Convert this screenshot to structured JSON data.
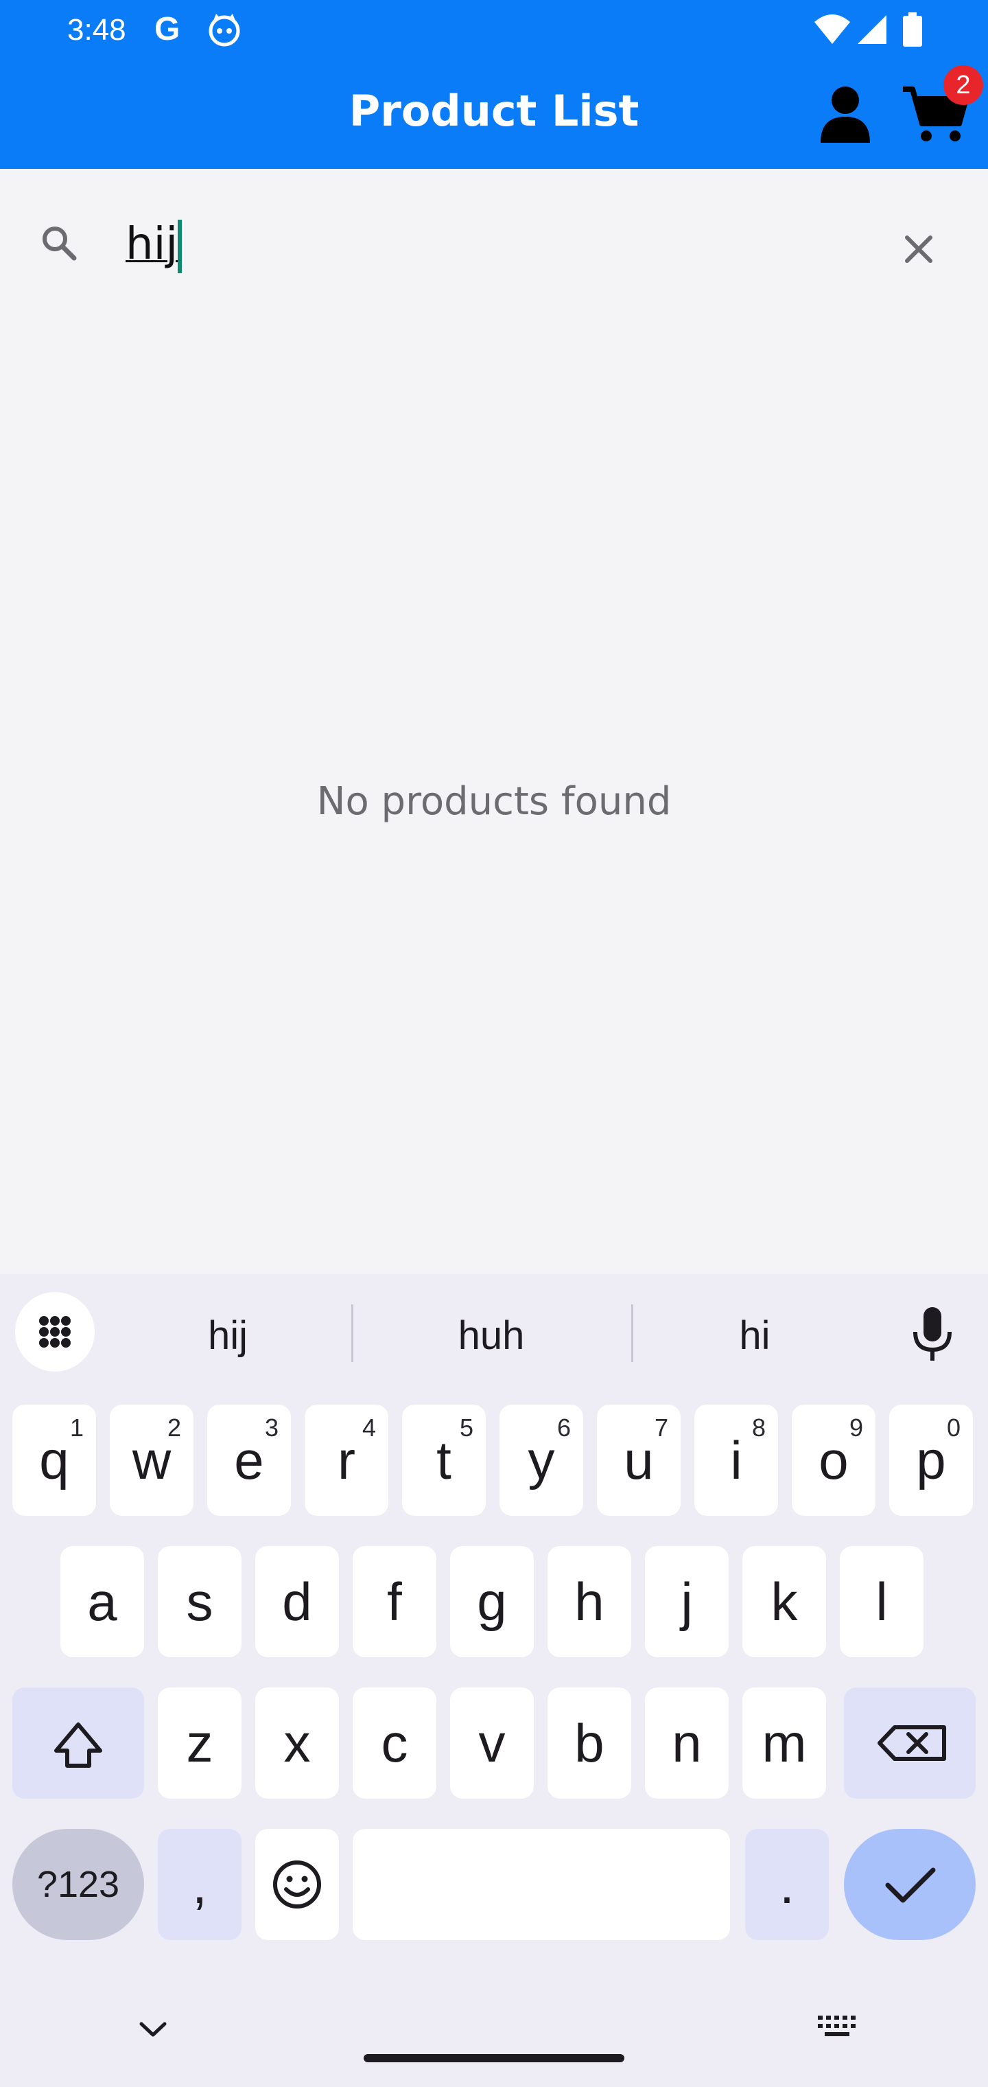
{
  "status_bar": {
    "time": "3:48",
    "google_letter": "G"
  },
  "app_bar": {
    "title": "Product List",
    "cart_badge": "2",
    "color": "#0a7cf7"
  },
  "search": {
    "value": "hij"
  },
  "empty_state": {
    "message": "No products found"
  },
  "keyboard": {
    "suggestions": [
      "hij",
      "huh",
      "hi"
    ],
    "row1": [
      {
        "k": "q",
        "h": "1"
      },
      {
        "k": "w",
        "h": "2"
      },
      {
        "k": "e",
        "h": "3"
      },
      {
        "k": "r",
        "h": "4"
      },
      {
        "k": "t",
        "h": "5"
      },
      {
        "k": "y",
        "h": "6"
      },
      {
        "k": "u",
        "h": "7"
      },
      {
        "k": "i",
        "h": "8"
      },
      {
        "k": "o",
        "h": "9"
      },
      {
        "k": "p",
        "h": "0"
      }
    ],
    "row2": [
      "a",
      "s",
      "d",
      "f",
      "g",
      "h",
      "j",
      "k",
      "l"
    ],
    "row3": [
      "z",
      "x",
      "c",
      "v",
      "b",
      "n",
      "m"
    ],
    "symbols_label": "?123",
    "comma_label": ",",
    "period_label": "."
  }
}
